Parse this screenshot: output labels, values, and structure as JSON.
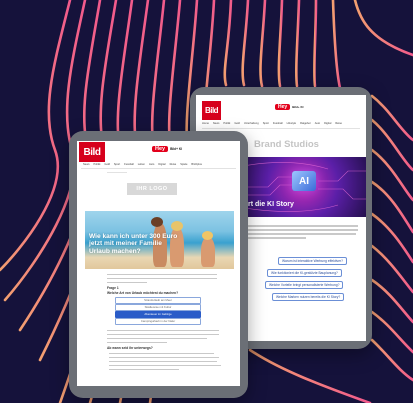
{
  "colors": {
    "background": "#15123b",
    "wave_pink": "#f25a8c",
    "wave_orange": "#f3a070",
    "bild_red": "#d6001c"
  },
  "back_tablet": {
    "bild_logo": "Bild",
    "hey_logo": "Hey",
    "hey_sub": "Bild+ KI",
    "nav_items": [
      "Home",
      "News",
      "Politik",
      "Geld",
      "Unterhaltung",
      "Sport",
      "Fussball",
      "Lifestyle",
      "Ratgeber",
      "Auto",
      "Digital",
      "Reise"
    ],
    "title": "Brand Studios",
    "hero_chip": "AI",
    "hero_title": "rt die KI Story",
    "fragment": "ie Story",
    "buttons": [
      "Warum ist interaktive Werbung effektiver?",
      "Wie funktioniert die KI-gestützte Bauplanung?",
      "Welche Vorteile bringt personalisierte Werbung?",
      "Welche Marken nutzen bereits die KI Story?"
    ]
  },
  "front_tablet": {
    "bild_logo": "Bild",
    "hey_logo": "Hey",
    "hey_sub": "Bild+ KI",
    "nav_items": [
      "News",
      "Politik",
      "Geld",
      "Sport",
      "Fussball",
      "Leben",
      "Auto",
      "Digital",
      "Reise",
      "Spiele",
      "BILDplus"
    ],
    "ad_text": "IHR LOGO",
    "hero_title_line1": "Wie kann ich unter 300 Euro",
    "hero_title_line2": "jetzt mit meiner Familie",
    "hero_title_line3": "Urlaub machen?",
    "question_label": "Frage 1",
    "question_text": "Welche Art von Urlaub möchtest du machen?",
    "options": [
      "Strandurlaub am Meer",
      "Städtereise mit Kultur",
      "Abenteuer im Gebirge",
      "Campingurlaub in der Natur"
    ],
    "selected_option_index": 2,
    "section_heading": "Ab wann seid ihr unterwegs?"
  }
}
